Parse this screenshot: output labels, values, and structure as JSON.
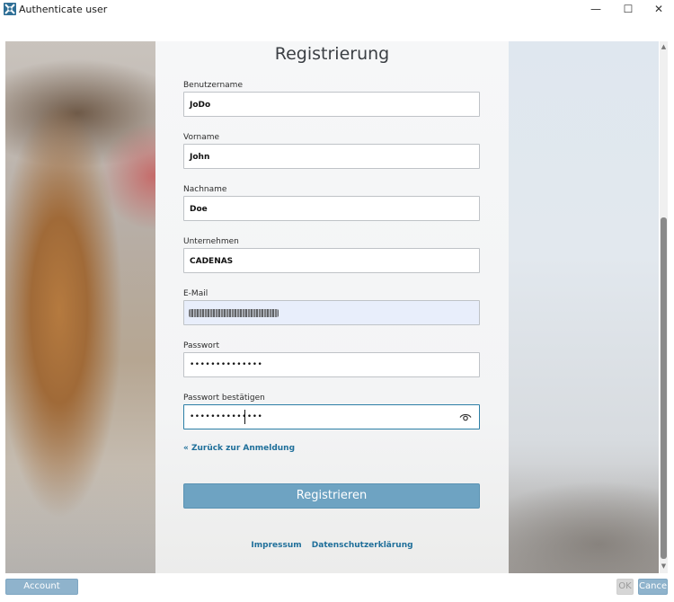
{
  "window": {
    "title": "Authenticate user",
    "minimize_glyph": "—",
    "maximize_glyph": "☐",
    "close_glyph": "✕"
  },
  "form": {
    "title": "Registrierung",
    "fields": [
      {
        "label": "Benutzername",
        "value": "JoDo"
      },
      {
        "label": "Vorname",
        "value": "John"
      },
      {
        "label": "Nachname",
        "value": "Doe"
      },
      {
        "label": "Unternehmen",
        "value": "CADENAS"
      },
      {
        "label": "E-Mail",
        "value": ""
      },
      {
        "label": "Passwort",
        "value": "••••••••••••••"
      },
      {
        "label": "Passwort bestätigen",
        "value": "••••••••••••••"
      }
    ],
    "back_link": "« Zurück zur Anmeldung",
    "submit_label": "Registrieren",
    "footer_links": [
      "Impressum",
      "Datenschutzerklärung"
    ]
  },
  "bottom_bar": {
    "account_selection": "Account selection",
    "ok": "OK",
    "cancel": "Cancel"
  },
  "scrollbar": {
    "up_glyph": "▲",
    "down_glyph": "▼"
  },
  "colors": {
    "accent": "#1f6f9a",
    "submit_button": "#6ea3c2",
    "focus_border": "#2c7fa6",
    "bottom_button": "#8fb3cc"
  }
}
